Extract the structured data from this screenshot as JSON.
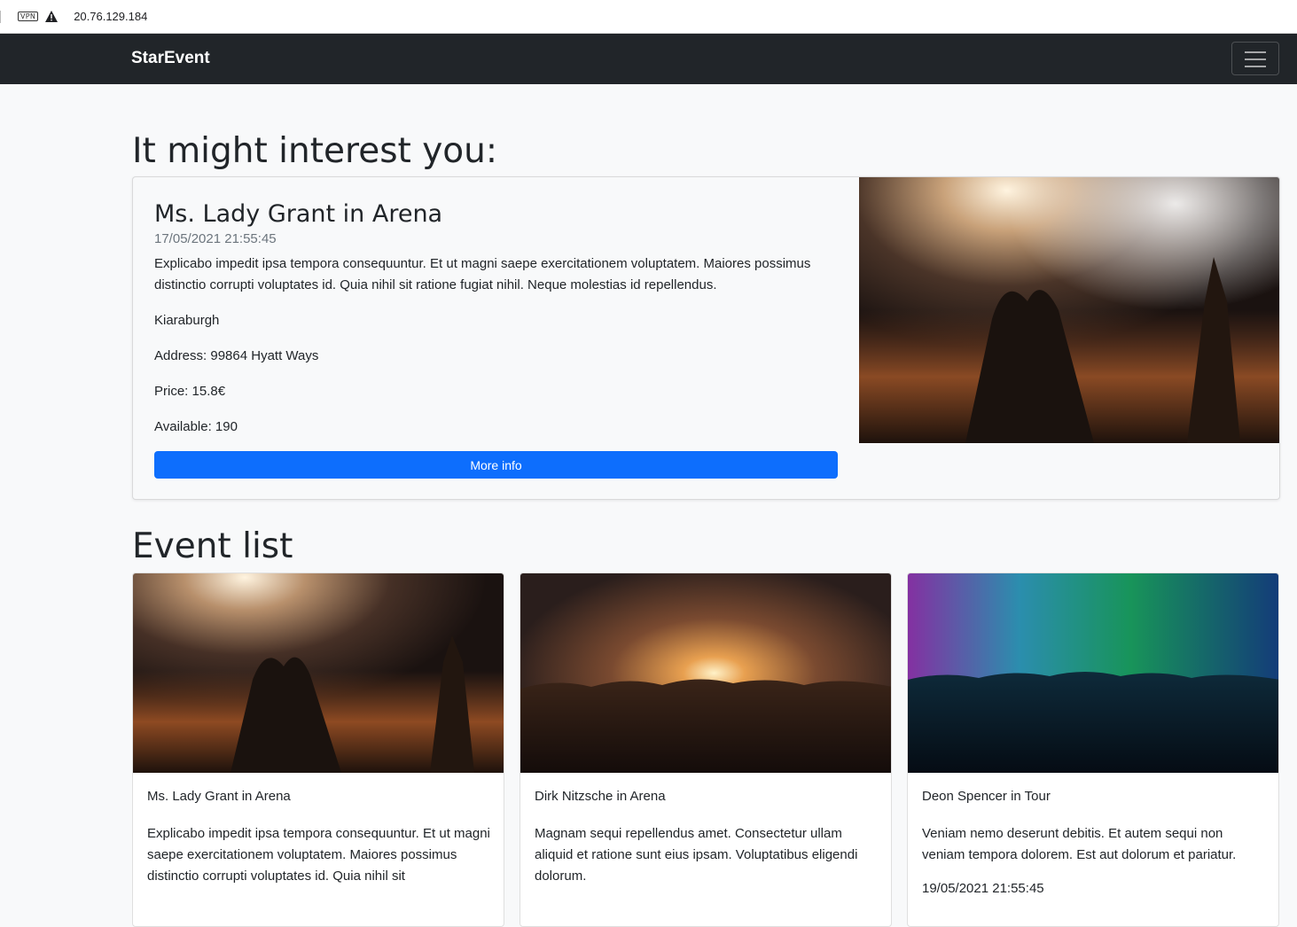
{
  "browser": {
    "vpn_label": "VPN",
    "address": "20.76.129.184"
  },
  "navbar": {
    "brand": "StarEvent",
    "toggler_icon": "hamburger-icon"
  },
  "featured_section": {
    "heading": "It might interest you:",
    "event": {
      "title": "Ms. Lady Grant in Arena",
      "date": "17/05/2021 21:55:45",
      "description": "Explicabo impedit ipsa tempora consequuntur. Et ut magni saepe exercitationem voluptatem. Maiores possimus distinctio corrupti voluptates id. Quia nihil sit ratione fugiat nihil. Neque molestias id repellendus.",
      "city": "Kiaraburgh",
      "address": "Address: 99864 Hyatt Ways",
      "price": "Price: 15.8€",
      "available": "Available: 190",
      "button_label": "More info"
    }
  },
  "event_list": {
    "heading": "Event list",
    "events": [
      {
        "title": "Ms. Lady Grant in Arena",
        "description": "Explicabo impedit ipsa tempora consequuntur. Et ut magni saepe exercitationem voluptatem. Maiores possimus distinctio corrupti voluptates id. Quia nihil sit",
        "date": ""
      },
      {
        "title": "Dirk Nitzsche in Arena",
        "description": "Magnam sequi repellendus amet. Consectetur ullam aliquid et ratione sunt eius ipsam. Voluptatibus eligendi dolorum.",
        "date": ""
      },
      {
        "title": "Deon Spencer in Tour",
        "description": "Veniam nemo deserunt debitis. Et autem sequi non veniam tempora dolorem. Est aut dolorum et pariatur.",
        "date": "19/05/2021 21:55:45"
      }
    ]
  },
  "colors": {
    "navbar_bg": "#212529",
    "page_bg": "#f8f9fa",
    "primary": "#0d6efd",
    "muted": "#6c757d"
  }
}
